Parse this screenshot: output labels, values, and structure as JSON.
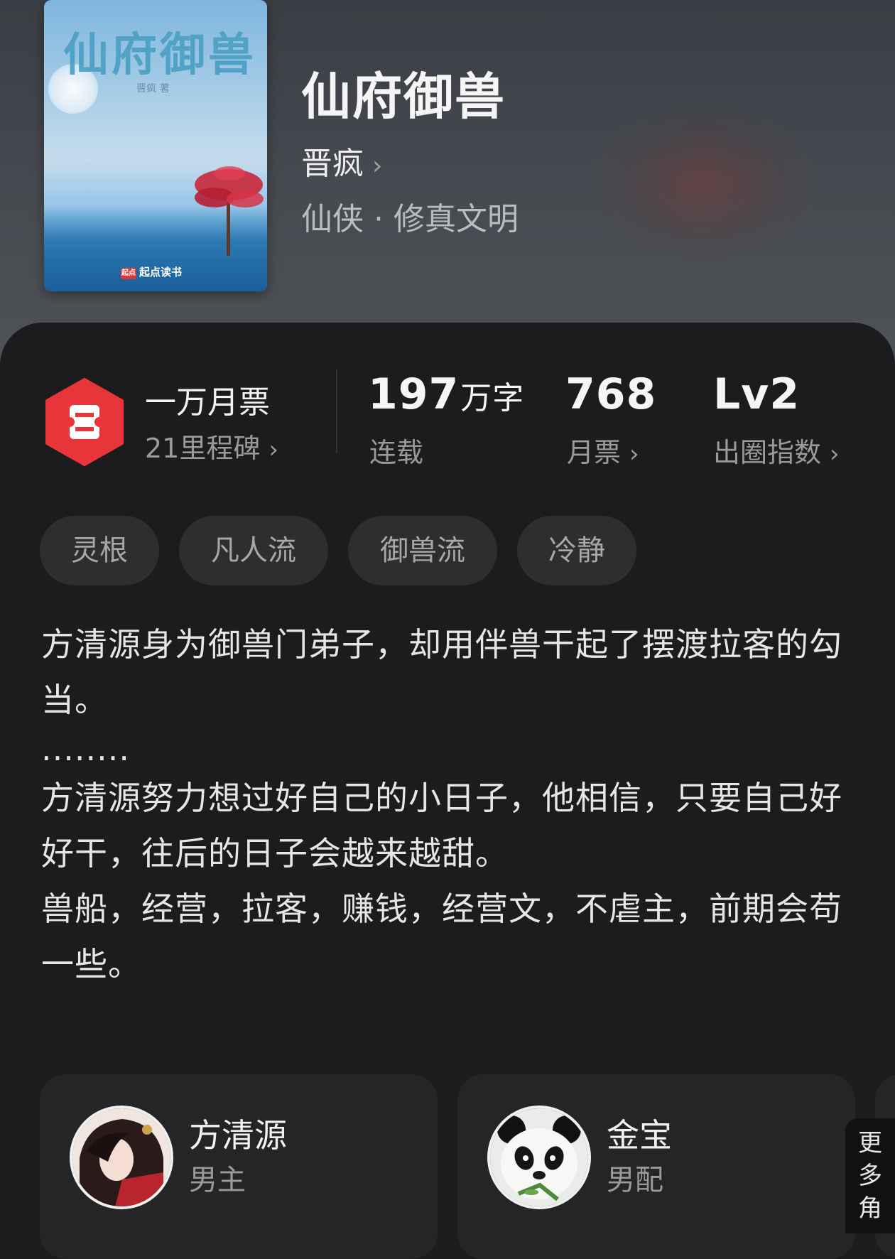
{
  "book": {
    "cover_title": "仙府御兽",
    "cover_author": "晋疯 著",
    "cover_publisher": "起点读书",
    "cover_publisher_logo": "起点",
    "title": "仙府御兽",
    "author": "晋疯",
    "genre": "仙侠 · 修真文明"
  },
  "stats": {
    "ticket_title": "一万月票",
    "ticket_sub": "21里程碑",
    "words_num": "197",
    "words_unit": "万字",
    "words_status": "连载",
    "monthly_num": "768",
    "monthly_label": "月票",
    "level_num": "Lv2",
    "level_label": "出圈指数"
  },
  "tags": [
    "灵根",
    "凡人流",
    "御兽流",
    "冷静"
  ],
  "description": {
    "line1": "方清源身为御兽门弟子，却用伴兽干起了摆渡拉客的勾当。",
    "line2": "........",
    "line3": "方清源努力想过好自己的小日子，他相信，只要自己好好干，往后的日子会越来越甜。",
    "line4": "兽船，经营，拉客，赚钱，经营文，不虐主，前期会苟一些。"
  },
  "characters": [
    {
      "name": "方清源",
      "role": "男主"
    },
    {
      "name": "金宝",
      "role": "男配"
    }
  ],
  "more_roles_label": "更多角",
  "colors": {
    "accent_red": "#e8353a",
    "header_bg": "#43474d",
    "card_bg": "#1c1c1e",
    "tag_bg": "#2e2e30"
  },
  "icons": {
    "ticket": "ticket-badge-icon",
    "chevron": "chevron-right-icon"
  }
}
